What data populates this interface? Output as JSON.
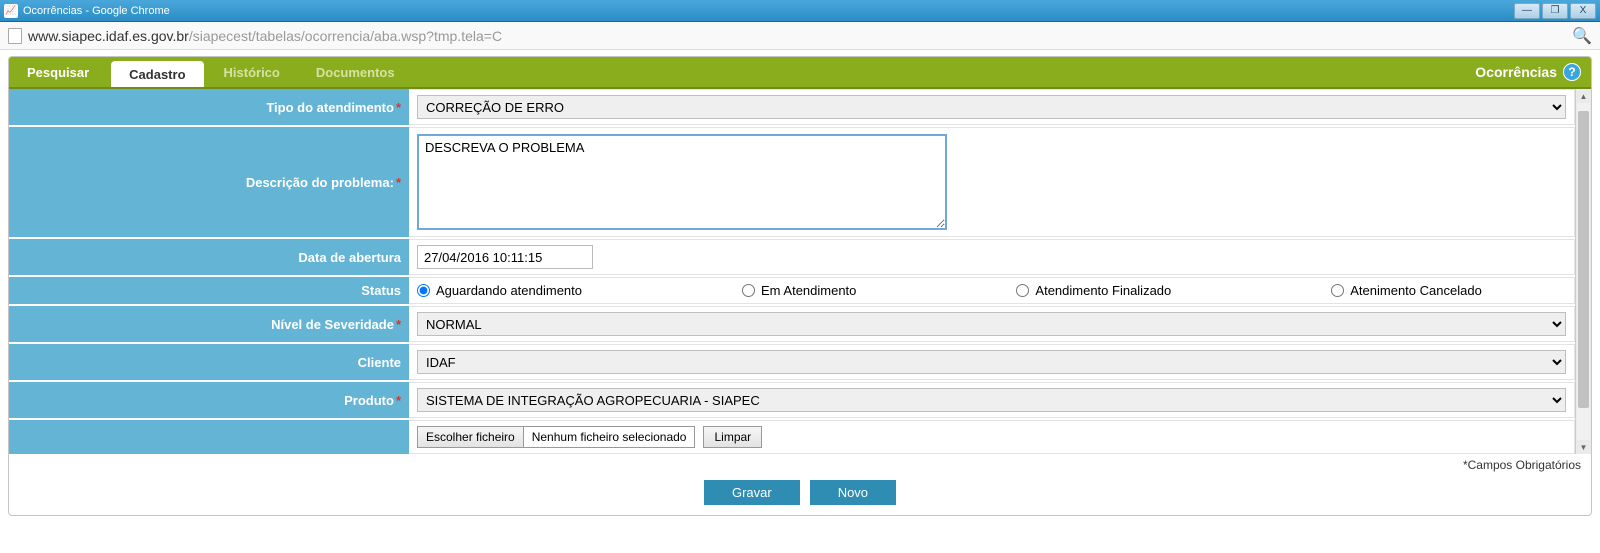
{
  "window": {
    "title": "Ocorrências - Google Chrome"
  },
  "url": {
    "host": "www.siapec.idaf.es.gov.br",
    "path": "/siapecest/tabelas/ocorrencia/aba.wsp?tmp.tela=C"
  },
  "tabs": {
    "pesquisar": "Pesquisar",
    "cadastro": "Cadastro",
    "historico": "Histórico",
    "documentos": "Documentos"
  },
  "header": {
    "title": "Ocorrências"
  },
  "form": {
    "labels": {
      "tipo": "Tipo do atendimento",
      "descricao": "Descrição do problema:",
      "data": "Data de abertura",
      "status": "Status",
      "severidade": "Nível de Severidade",
      "cliente": "Cliente",
      "produto": "Produto"
    },
    "tipo_value": "CORREÇÃO DE ERRO",
    "descricao_value": "DESCREVA O PROBLEMA",
    "data_value": "27/04/2016 10:11:15",
    "status_options": {
      "a": "Aguardando atendimento",
      "b": "Em Atendimento",
      "c": "Atendimento Finalizado",
      "d": "Atenimento Cancelado"
    },
    "severidade_value": "NORMAL",
    "cliente_value": "IDAF",
    "produto_value": "SISTEMA DE INTEGRAÇÃO AGROPECUARIA - SIAPEC",
    "file": {
      "choose": "Escolher ficheiro",
      "none": "Nenhum ficheiro selecionado",
      "clear": "Limpar"
    },
    "req_note": "*Campos Obrigatórios",
    "actions": {
      "save": "Gravar",
      "novo": "Novo"
    }
  },
  "win_btns": {
    "min": "—",
    "max": "❐",
    "close": "X"
  }
}
